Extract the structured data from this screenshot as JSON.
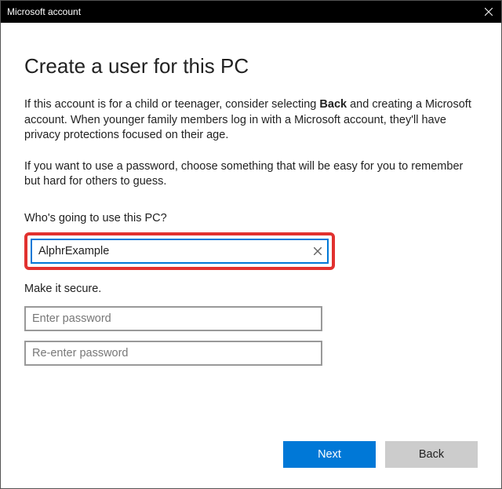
{
  "titlebar": {
    "title": "Microsoft account"
  },
  "page": {
    "heading": "Create a user for this PC",
    "paragraph1_before": "If this account is for a child or teenager, consider selecting ",
    "paragraph1_bold": "Back",
    "paragraph1_after": " and creating a Microsoft account. When younger family members log in with a Microsoft account, they'll have privacy protections focused on their age.",
    "paragraph2": "If you want to use a password, choose something that will be easy for you to remember but hard for others to guess."
  },
  "form": {
    "user_label": "Who's going to use this PC?",
    "username_value": "AlphrExample",
    "secure_label": "Make it secure.",
    "password_placeholder": "Enter password",
    "password2_placeholder": "Re-enter password"
  },
  "buttons": {
    "next": "Next",
    "back": "Back"
  }
}
